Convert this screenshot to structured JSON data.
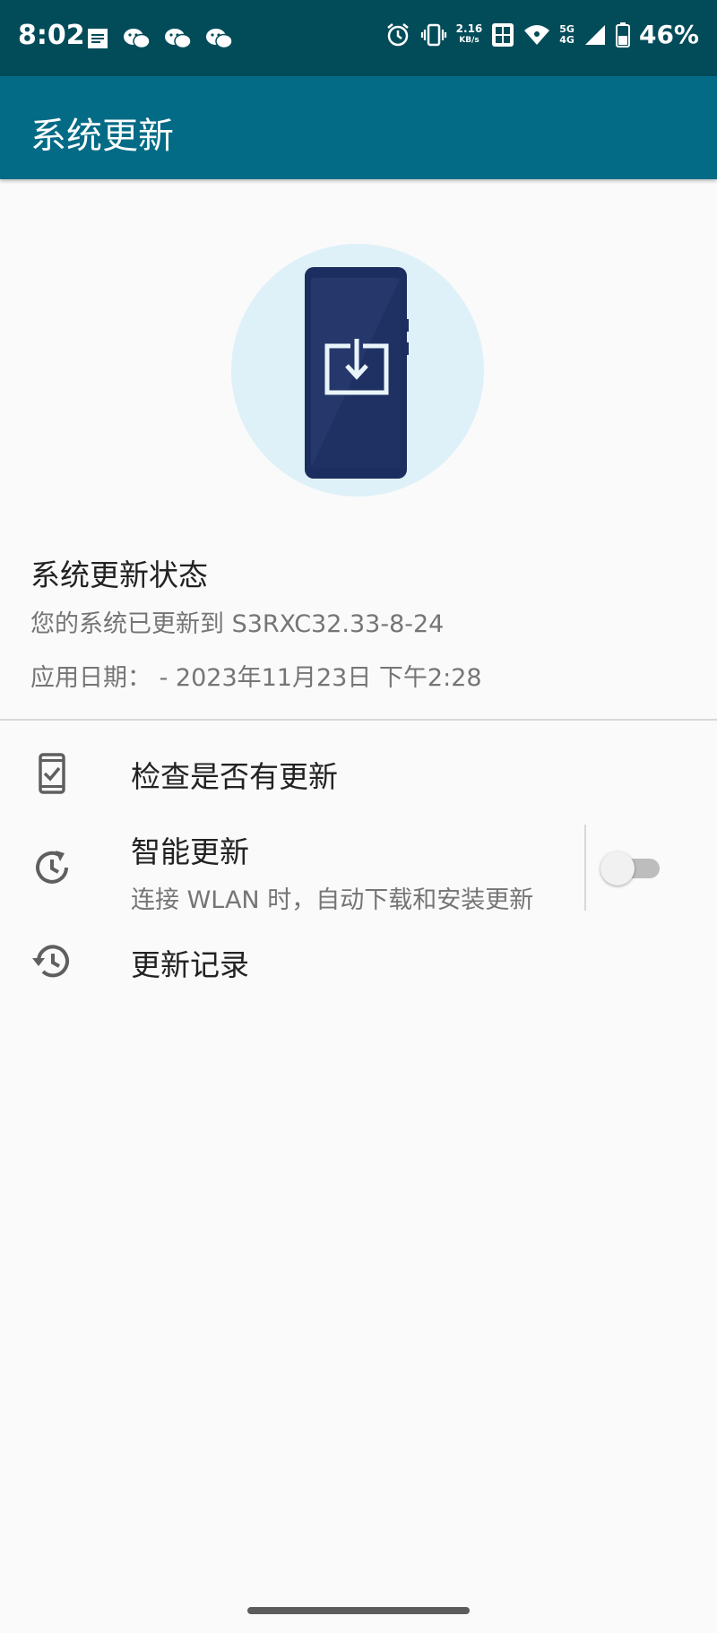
{
  "status_bar": {
    "time": "8:02",
    "net_speed_value": "2.16",
    "net_speed_unit": "KB/s",
    "network_top": "5G",
    "network_bottom": "4G",
    "battery": "46%",
    "left_icons": [
      "notes-icon",
      "wechat-icon",
      "wechat-icon",
      "wechat-icon"
    ],
    "right_icons": [
      "alarm-icon",
      "vibrate-icon",
      "hd-icon",
      "wifi-icon",
      "signal-icon",
      "battery-icon"
    ]
  },
  "app_bar": {
    "title": "系统更新",
    "color": "#036b86"
  },
  "status_section": {
    "title": "系统更新状态",
    "description": "您的系统已更新到 S3RXC32.33-8-24",
    "date": "应用日期： - 2023年11月23日 下午2:28"
  },
  "menu": {
    "check_updates": {
      "title": "检查是否有更新",
      "icon": "phone-check-icon"
    },
    "smart_update": {
      "title": "智能更新",
      "subtitle": "连接 WLAN 时，自动下载和安装更新",
      "icon": "clock-refresh-icon",
      "enabled": false
    },
    "update_history": {
      "title": "更新记录",
      "icon": "history-icon"
    }
  }
}
